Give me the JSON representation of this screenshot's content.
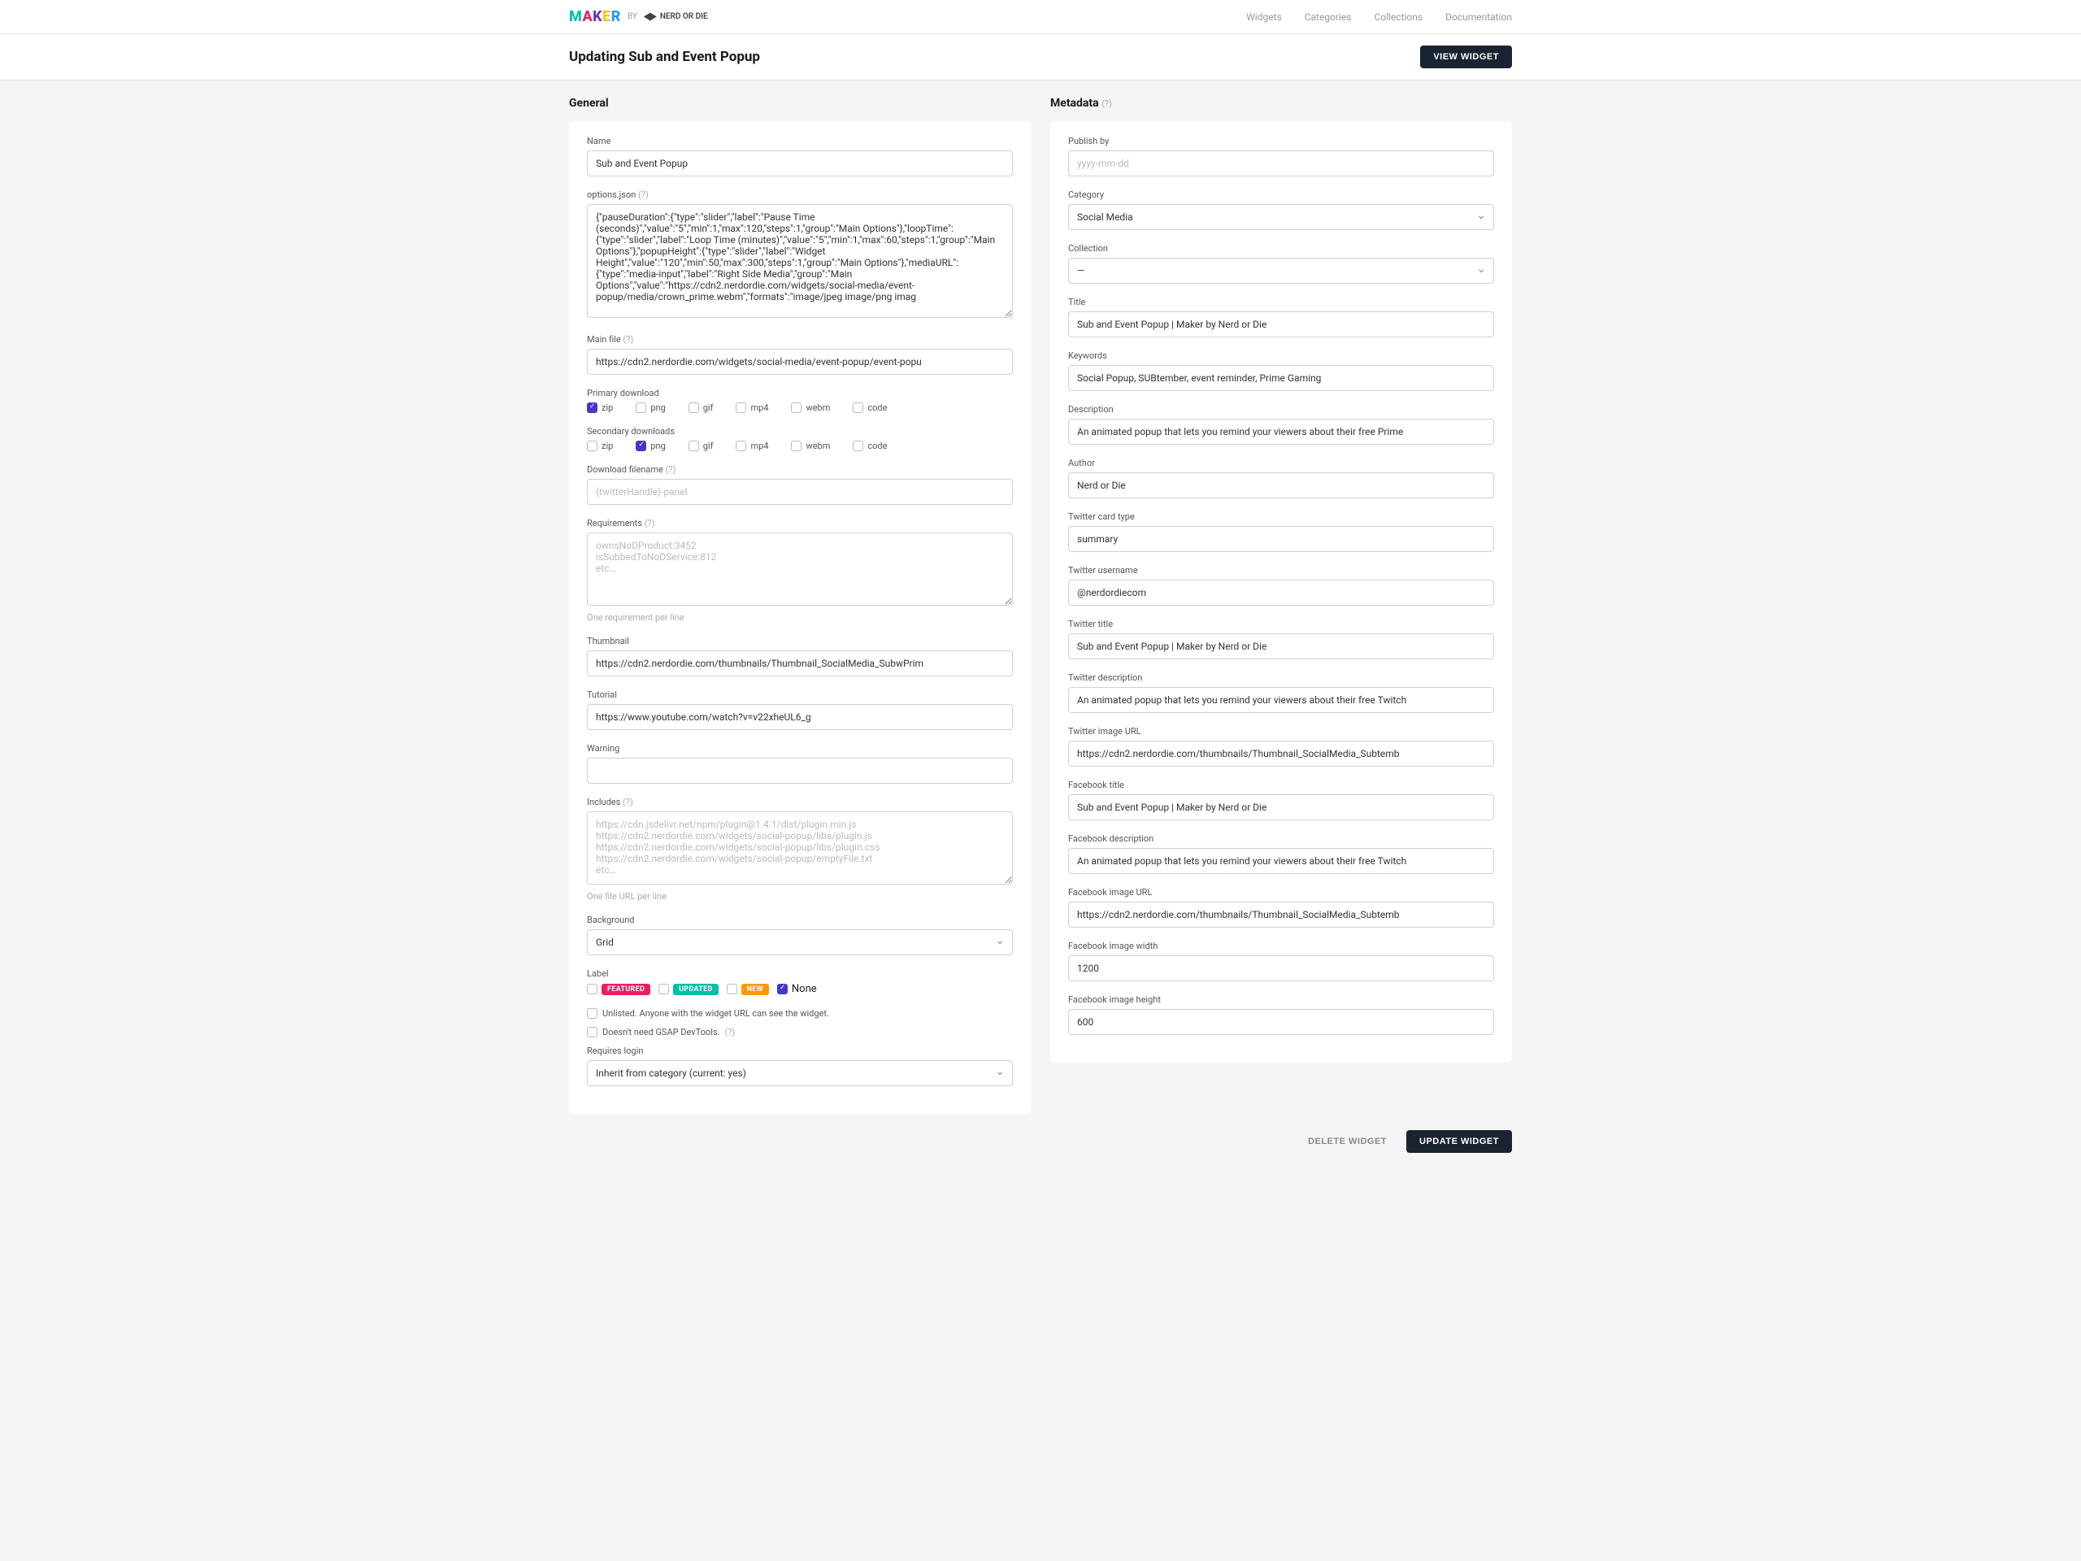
{
  "logo": {
    "by": "BY",
    "brand": "NERD OR DIE"
  },
  "nav": {
    "widgets": "Widgets",
    "categories": "Categories",
    "collections": "Collections",
    "documentation": "Documentation"
  },
  "header": {
    "title": "Updating Sub and Event Popup",
    "view_btn": "VIEW WIDGET"
  },
  "general": {
    "title": "General",
    "name_label": "Name",
    "name_value": "Sub and Event Popup",
    "options_label": "options.json",
    "options_value": "{\"pauseDuration\":{\"type\":\"slider\",\"label\":\"Pause Time (seconds)\",\"value\":\"5\",\"min\":1,\"max\":120,\"steps\":1,\"group\":\"Main Options\"},\"loopTime\":{\"type\":\"slider\",\"label\":\"Loop Time (minutes)\",\"value\":\"5\",\"min\":1,\"max\":60,\"steps\":1,\"group\":\"Main Options\"},\"popupHeight\":{\"type\":\"slider\",\"label\":\"Widget Height\",\"value\":\"120\",\"min\":50,\"max\":300,\"steps\":1,\"group\":\"Main Options\"},\"mediaURL\":{\"type\":\"media-input\",\"label\":\"Right Side Media\",\"group\":\"Main Options\",\"value\":\"https://cdn2.nerdordie.com/widgets/social-media/event-popup/media/crown_prime.webm\",\"formats\":\"image/jpeg image/png imag",
    "mainfile_label": "Main file",
    "mainfile_value": "https://cdn2.nerdordie.com/widgets/social-media/event-popup/event-popu",
    "primary_label": "Primary download",
    "secondary_label": "Secondary downloads",
    "formats": {
      "zip": "zip",
      "png": "png",
      "gif": "gif",
      "mp4": "mp4",
      "webm": "webm",
      "code": "code"
    },
    "dlfilename_label": "Download filename",
    "dlfilename_placeholder": "{twitterHandle}-panel",
    "requirements_label": "Requirements",
    "requirements_placeholder": "ownsNoDProduct:3452\nisSubbedToNoDService:812\netc…",
    "requirements_hint": "One requirement per line",
    "thumbnail_label": "Thumbnail",
    "thumbnail_value": "https://cdn2.nerdordie.com/thumbnails/Thumbnail_SocialMedia_SubwPrim",
    "tutorial_label": "Tutorial",
    "tutorial_value": "https://www.youtube.com/watch?v=v22xheUL6_g",
    "warning_label": "Warning",
    "warning_value": "",
    "includes_label": "Includes",
    "includes_placeholder": "https://cdn.jsdelivr.net/npm/plugin@1.4.1/dist/plugin.min.js\nhttps://cdn2.nerdordie.com/widgets/social-popup/libs/plugin.js\nhttps://cdn2.nerdordie.com/widgets/social-popup/libs/plugin.css\nhttps://cdn2.nerdordie.com/widgets/social-popup/emptyFile.txt\netc…",
    "includes_hint": "One file URL per line",
    "background_label": "Background",
    "background_value": "Grid",
    "label_label": "Label",
    "labels": {
      "featured": "FEATURED",
      "updated": "UPDATED",
      "new": "NEW",
      "none": "None"
    },
    "unlisted_text": "Unlisted. Anyone with the widget URL can see the widget.",
    "gsap_text": "Doesn't need GSAP DevTools.",
    "requires_login_label": "Requires login",
    "requires_login_value": "Inherit from category (current: yes)"
  },
  "metadata": {
    "title": "Metadata",
    "publish_label": "Publish by",
    "publish_placeholder": "yyyy-mm-dd",
    "category_label": "Category",
    "category_value": "Social Media",
    "collection_label": "Collection",
    "collection_value": "—",
    "mtitle_label": "Title",
    "mtitle_value": "Sub and Event Popup | Maker by Nerd or Die",
    "keywords_label": "Keywords",
    "keywords_value": "Social Popup, SUBtember, event reminder, Prime Gaming",
    "description_label": "Description",
    "description_value": "An animated popup that lets you remind your viewers about their free Prime",
    "author_label": "Author",
    "author_value": "Nerd or Die",
    "twcard_label": "Twitter card type",
    "twcard_value": "summary",
    "twuser_label": "Twitter username",
    "twuser_value": "@nerdordiecom",
    "twtitle_label": "Twitter title",
    "twtitle_value": "Sub and Event Popup | Maker by Nerd or Die",
    "twdesc_label": "Twitter description",
    "twdesc_value": "An animated popup that lets you remind your viewers about their free Twitch",
    "twimg_label": "Twitter image URL",
    "twimg_value": "https://cdn2.nerdordie.com/thumbnails/Thumbnail_SocialMedia_Subtemb",
    "fbtitle_label": "Facebook title",
    "fbtitle_value": "Sub and Event Popup | Maker by Nerd or Die",
    "fbdesc_label": "Facebook description",
    "fbdesc_value": "An animated popup that lets you remind your viewers about their free Twitch",
    "fbimg_label": "Facebook image URL",
    "fbimg_value": "https://cdn2.nerdordie.com/thumbnails/Thumbnail_SocialMedia_Subtemb",
    "fbw_label": "Facebook image width",
    "fbw_value": "1200",
    "fbh_label": "Facebook image height",
    "fbh_value": "600"
  },
  "footer": {
    "delete": "DELETE WIDGET",
    "update": "UPDATE WIDGET"
  },
  "help_q": "(?)"
}
